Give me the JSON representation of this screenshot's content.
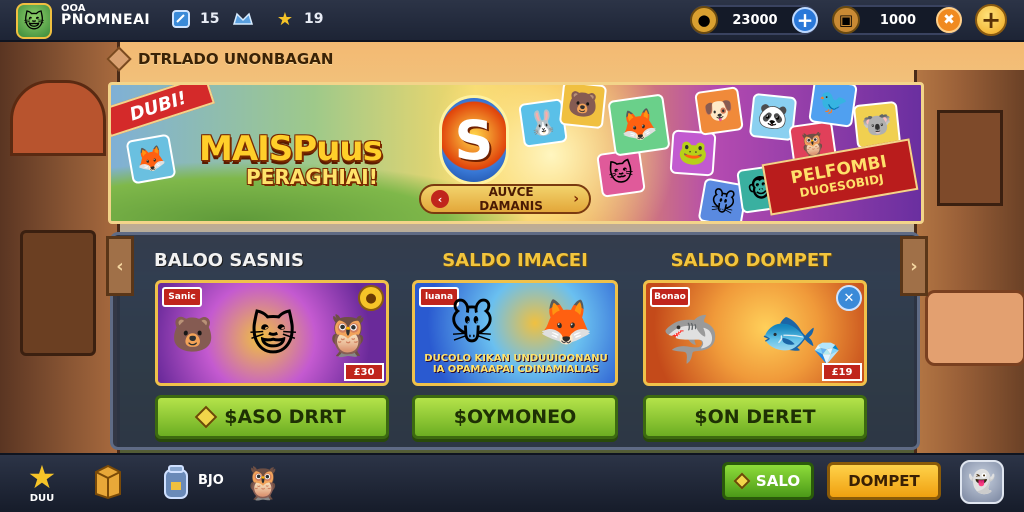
{
  "topbar": {
    "player_level": "OOA",
    "player_name": "PNOMNEAI",
    "stat_shield": "15",
    "stat_star": "19",
    "currency_coins": "23000",
    "currency_gems": "1000"
  },
  "section_title": "DTRLADO UNONBAGAN",
  "promo": {
    "ribbon": "DUBI!",
    "title": "MAISPuus",
    "subtitle": "PERAGHIAI!",
    "logo_letter": "S",
    "button_label": "AUVCE DAMANIS",
    "corner_line1": "PELFOMBI",
    "corner_line2": "DUOESOBIDJ"
  },
  "wallets": [
    {
      "title": "BALOO SASNIS",
      "tag": "Sanic",
      "card_amount": "£30",
      "caption": "",
      "button_label": "$ASO DRRT",
      "colors": {
        "bg1": "#6a2a9a",
        "bg2": "#c45ad0",
        "bg3": "#f08a3a"
      }
    },
    {
      "title": "SALDO IMACEI",
      "tag": "luana",
      "card_amount": "",
      "caption": "DUCOLO KIKAN UNDUUIOONANU IA OPAMAAPAI CDINAMIALIAS",
      "button_label": "$OYMONEO",
      "colors": {
        "bg1": "#2a5ad0",
        "bg2": "#6ac0f0",
        "bg3": "#f0c040"
      }
    },
    {
      "title": "SALDO DOMPET",
      "tag": "Bonao",
      "card_amount": "£19",
      "caption": "",
      "button_label": "$ON DERET",
      "colors": {
        "bg1": "#c44a1a",
        "bg2": "#f09a3a",
        "bg3": "#7a2a90"
      }
    }
  ],
  "bottombar": {
    "star_label": "DUU",
    "value": "BJO",
    "btn_salo": "SALO",
    "btn_dompet": "DOMPET"
  }
}
